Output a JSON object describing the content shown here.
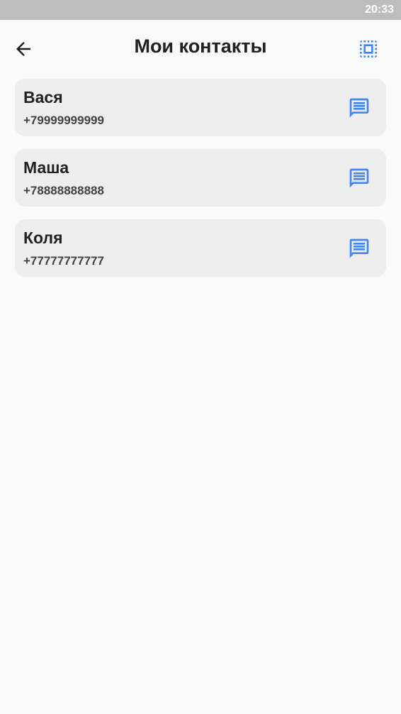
{
  "status_bar": {
    "time": "20:33"
  },
  "header": {
    "title": "Мои контакты",
    "back_icon": "arrow-left-icon",
    "select_icon": "select-all-icon"
  },
  "contacts": [
    {
      "name": "Вася",
      "phone": "+79999999999"
    },
    {
      "name": "Маша",
      "phone": "+78888888888"
    },
    {
      "name": "Коля",
      "phone": "+77777777777"
    }
  ],
  "theme": {
    "accent": "#4285f4",
    "card_background": "#eeeeee",
    "page_background": "#fafafa",
    "status_bar": "#bdbdbd"
  }
}
